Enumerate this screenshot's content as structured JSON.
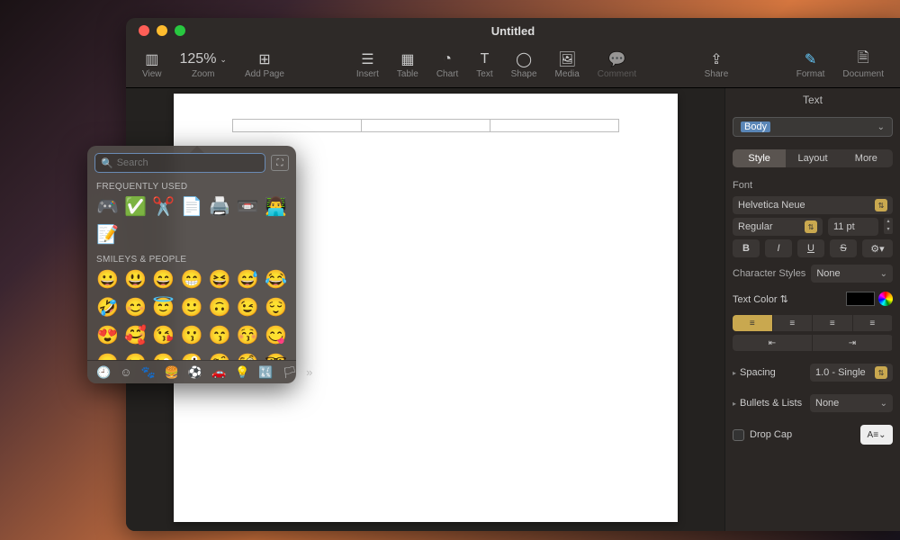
{
  "window": {
    "title": "Untitled"
  },
  "toolbar": {
    "view": "View",
    "zoom_label": "Zoom",
    "zoom_value": "125%",
    "add_page": "Add Page",
    "insert": "Insert",
    "table": "Table",
    "chart": "Chart",
    "text": "Text",
    "shape": "Shape",
    "media": "Media",
    "comment": "Comment",
    "share": "Share",
    "format": "Format",
    "document": "Document"
  },
  "inspector": {
    "title": "Text",
    "style_value": "Body",
    "tabs": {
      "style": "Style",
      "layout": "Layout",
      "more": "More"
    },
    "font_label": "Font",
    "font_family": "Helvetica Neue",
    "font_weight": "Regular",
    "font_size": "11 pt",
    "char_styles_label": "Character Styles",
    "char_styles_value": "None",
    "text_color_label": "Text Color",
    "spacing_label": "Spacing",
    "spacing_value": "1.0 - Single",
    "bullets_label": "Bullets & Lists",
    "bullets_value": "None",
    "dropcap_label": "Drop Cap",
    "dropcap_preview": "A≡"
  },
  "emoji": {
    "search_placeholder": "Search",
    "freq_label": "FREQUENTLY USED",
    "freq_items": [
      "🎮",
      "✅",
      "✂️",
      "📄",
      "🖨️",
      "📼",
      "👨‍💻",
      "📝"
    ],
    "smileys_label": "SMILEYS & PEOPLE",
    "smileys_items": [
      "😀",
      "😃",
      "😄",
      "😁",
      "😆",
      "😅",
      "😂",
      "🤣",
      "😊",
      "😇",
      "🙂",
      "🙃",
      "😉",
      "😌",
      "😍",
      "🥰",
      "😘",
      "😗",
      "😙",
      "😚",
      "😋",
      "😛",
      "😝",
      "😜",
      "🤪",
      "🤨",
      "🧐",
      "🤓"
    ]
  }
}
